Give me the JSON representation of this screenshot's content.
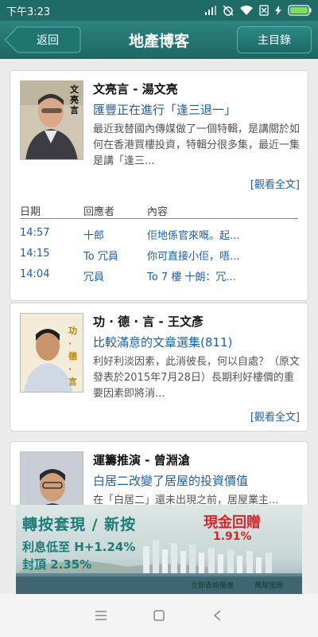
{
  "status": {
    "time": "下午3:23"
  },
  "header": {
    "back_label": "返回",
    "title": "地產博客",
    "home_label": "主目錄"
  },
  "posts": [
    {
      "author": "文亮言 - 湯文亮",
      "thumb_text": "文亮言",
      "headline": "匯豐正在進行「逢三退一」",
      "excerpt": "最近我替國內傳媒做了一個特輯，是講關於如何在香港買樓投資，特輯分很多集，最近一集是講「逢三...",
      "read_more": "[觀看全文]",
      "reply_headers": {
        "date": "日期",
        "responder": "回應者",
        "content": "內容"
      },
      "replies": [
        {
          "date": "14:57",
          "responder": "十郎",
          "content": "佢地係官來嘅。起..."
        },
        {
          "date": "14:15",
          "responder": "To 冗員",
          "content": "你可直接小佢，唔..."
        },
        {
          "date": "14:04",
          "responder": "冗員",
          "content": "To 7 樓 十朗：冗..."
        }
      ]
    },
    {
      "author": "功 · 德 · 言 - 王文彥",
      "thumb_text": "功·德·言",
      "headline": "比較滿意的文章選集(811)",
      "excerpt": "利好利淡因素，此消彼長，何以自處？（原文發表於2015年7月28日）長期利好樓價的重要因素即將消...",
      "read_more": "[觀看全文]"
    },
    {
      "author": "運籌推演 - 曾淵滄",
      "headline": "白居二改變了居屋的投資價值",
      "excerpt": "在「白居二」還未出現之前，居屋業主..."
    }
  ],
  "ad": {
    "line1": "轉按套現 / 新按",
    "line2": "利息低至 H+1.24%",
    "line3": "封頂 2.35%",
    "promo": "現金回贈",
    "promo_rate": "1.91%",
    "footer1": "立即查詢優惠",
    "footer2": "萬幫按揭"
  }
}
